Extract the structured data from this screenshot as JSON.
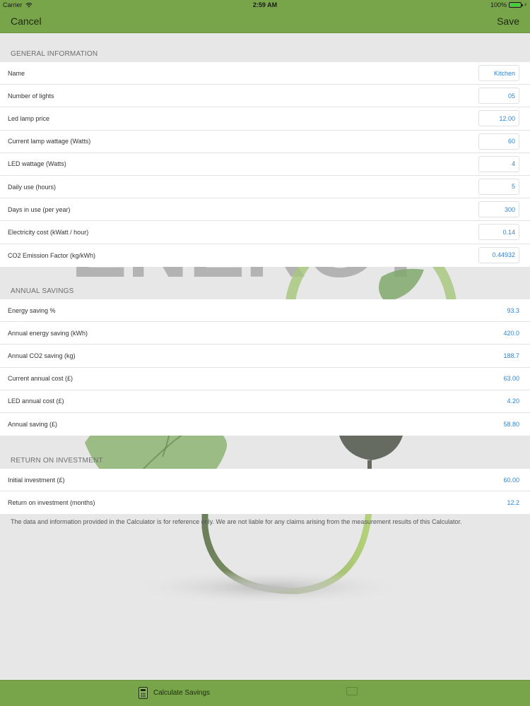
{
  "status_bar": {
    "carrier": "Carrier",
    "time": "2:59 AM",
    "battery": "100%",
    "battery_level": 1.0
  },
  "nav": {
    "cancel": "Cancel",
    "save": "Save"
  },
  "general": {
    "header": "GENERAL INFORMATION",
    "rows": [
      {
        "label": "Name",
        "value": "Kitchen"
      },
      {
        "label": "Number of lights",
        "value": "05"
      },
      {
        "label": "Led lamp price",
        "value": "12.00"
      },
      {
        "label": "Current lamp wattage (Watts)",
        "value": "60"
      },
      {
        "label": "LED wattage (Watts)",
        "value": "4"
      },
      {
        "label": "Daily use (hours)",
        "value": "5"
      },
      {
        "label": "Days in use (per year)",
        "value": "300"
      },
      {
        "label": "Electricity cost (kWatt / hour)",
        "value": "0.14"
      },
      {
        "label": "CO2 Emission Factor (kg/kWh)",
        "value": "0.44932"
      }
    ]
  },
  "annual": {
    "header": "ANNUAL SAVINGS",
    "rows": [
      {
        "label": "Energy saving %",
        "value": "93.3"
      },
      {
        "label": "Annual energy saving (kWh)",
        "value": "420.0"
      },
      {
        "label": "Annual CO2 saving (kg)",
        "value": "188.7"
      },
      {
        "label": "Current annual cost (£)",
        "value": "63.00"
      },
      {
        "label": "LED annual cost (£)",
        "value": "4.20"
      },
      {
        "label": "Annual saving (£)",
        "value": "58.80"
      }
    ]
  },
  "roi": {
    "header": "RETURN ON INVESTMENT",
    "rows": [
      {
        "label": "Initial investment (£)",
        "value": "60.00"
      },
      {
        "label": "Return on investment (months)",
        "value": "12.2"
      }
    ]
  },
  "disclaimer": "The data and information provided in the Calculator is for reference only. We are not liable for any claims arising from the measurement results of this Calculator.",
  "tab_bar": {
    "calculate": "Calculate Savings"
  },
  "colors": {
    "accent": "#79a54a",
    "value_blue": "#2b86d6",
    "background": "#e7e7e7"
  },
  "icons": [
    "wifi-icon",
    "battery-icon",
    "calculator-icon",
    "leaf-bulb-watermark"
  ]
}
